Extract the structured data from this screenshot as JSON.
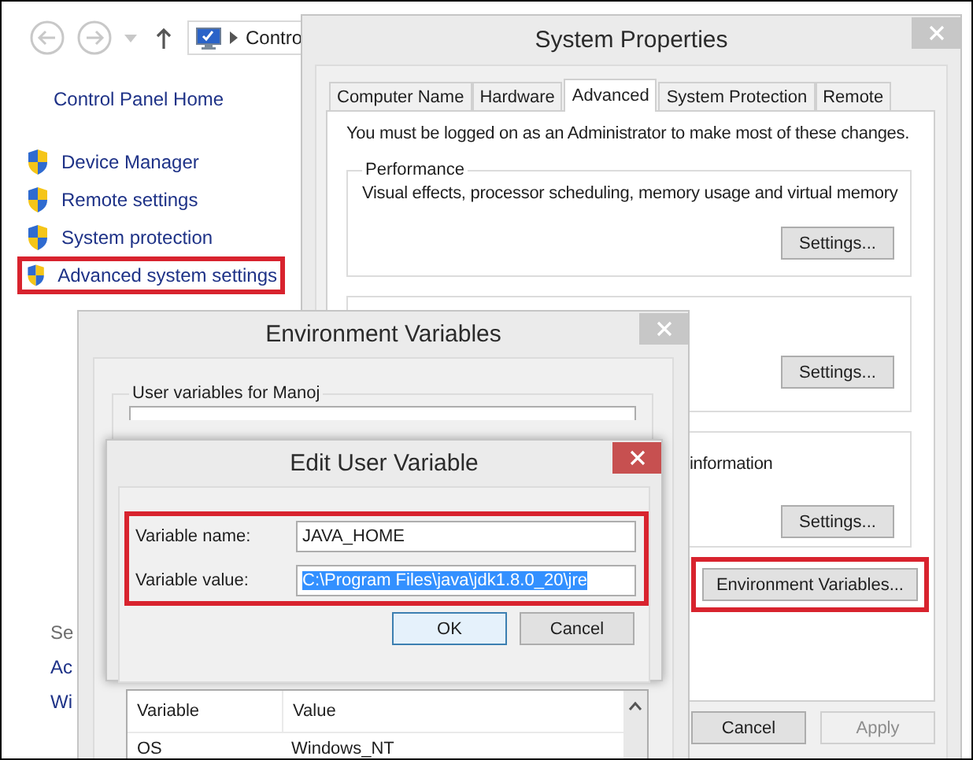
{
  "explorer": {
    "address": {
      "text": "Contro"
    },
    "sidebar": {
      "home": "Control Panel Home",
      "items": [
        {
          "label": "Device Manager",
          "highlighted": false
        },
        {
          "label": "Remote settings",
          "highlighted": false
        },
        {
          "label": "System protection",
          "highlighted": false
        },
        {
          "label": "Advanced system settings",
          "highlighted": true
        }
      ]
    },
    "see_also": [
      "Se",
      "Ac",
      "Wi"
    ]
  },
  "system_properties": {
    "title": "System Properties",
    "tabs": [
      {
        "label": "Computer Name",
        "selected": false
      },
      {
        "label": "Hardware",
        "selected": false
      },
      {
        "label": "Advanced",
        "selected": true
      },
      {
        "label": "System Protection",
        "selected": false
      },
      {
        "label": "Remote",
        "selected": false
      }
    ],
    "notice": "You must be logged on as an Administrator to make most of these changes.",
    "groups": [
      {
        "title": "Performance",
        "text": "Visual effects, processor scheduling, memory usage and virtual memory",
        "button": "Settings..."
      },
      {
        "button": "Settings..."
      },
      {
        "text": "information",
        "button": "Settings..."
      }
    ],
    "env_button": {
      "label": "Environment Variables...",
      "highlighted": true
    },
    "buttons": [
      {
        "label": "Cancel",
        "disabled": false
      },
      {
        "label": "Apply",
        "disabled": true
      }
    ]
  },
  "environment_variables": {
    "title": "Environment Variables",
    "user_group": {
      "title": "User variables for Manoj"
    },
    "system_table": {
      "columns": [
        "Variable",
        "Value"
      ],
      "rows": [
        [
          "OS",
          "Windows_NT"
        ]
      ]
    }
  },
  "edit_user_variable": {
    "title": "Edit User Variable",
    "highlighted": true,
    "fields": [
      {
        "label": "Variable name:",
        "value": "JAVA_HOME",
        "selected": false
      },
      {
        "label": "Variable value:",
        "value": "C:\\Program Files\\java\\jdk1.8.0_20\\jre",
        "selected": true
      }
    ],
    "buttons": [
      {
        "label": "OK",
        "default": true
      },
      {
        "label": "Cancel",
        "default": false
      }
    ]
  }
}
